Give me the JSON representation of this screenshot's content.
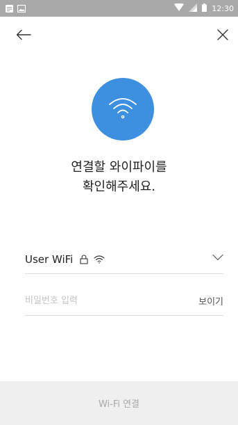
{
  "status_bar": {
    "time": "12:30",
    "icons": [
      "notification-icon",
      "image-icon",
      "wifi-signal-icon",
      "cellular-icon",
      "battery-icon"
    ]
  },
  "header": {
    "back_icon": "back-arrow-icon",
    "close_icon": "close-icon"
  },
  "hero": {
    "icon": "wifi-icon",
    "accent_color": "#3d8fe0"
  },
  "title": {
    "line1": "연결할 와이파이를",
    "line2": "확인해주세요."
  },
  "network": {
    "name": "User WiFi",
    "icons": [
      "lock-icon",
      "wifi-icon"
    ],
    "dropdown_icon": "chevron-down-icon"
  },
  "password": {
    "placeholder": "비밀번호 입력",
    "value": "",
    "show_label": "보이기"
  },
  "footer": {
    "connect_label": "Wi-Fi 연결"
  }
}
